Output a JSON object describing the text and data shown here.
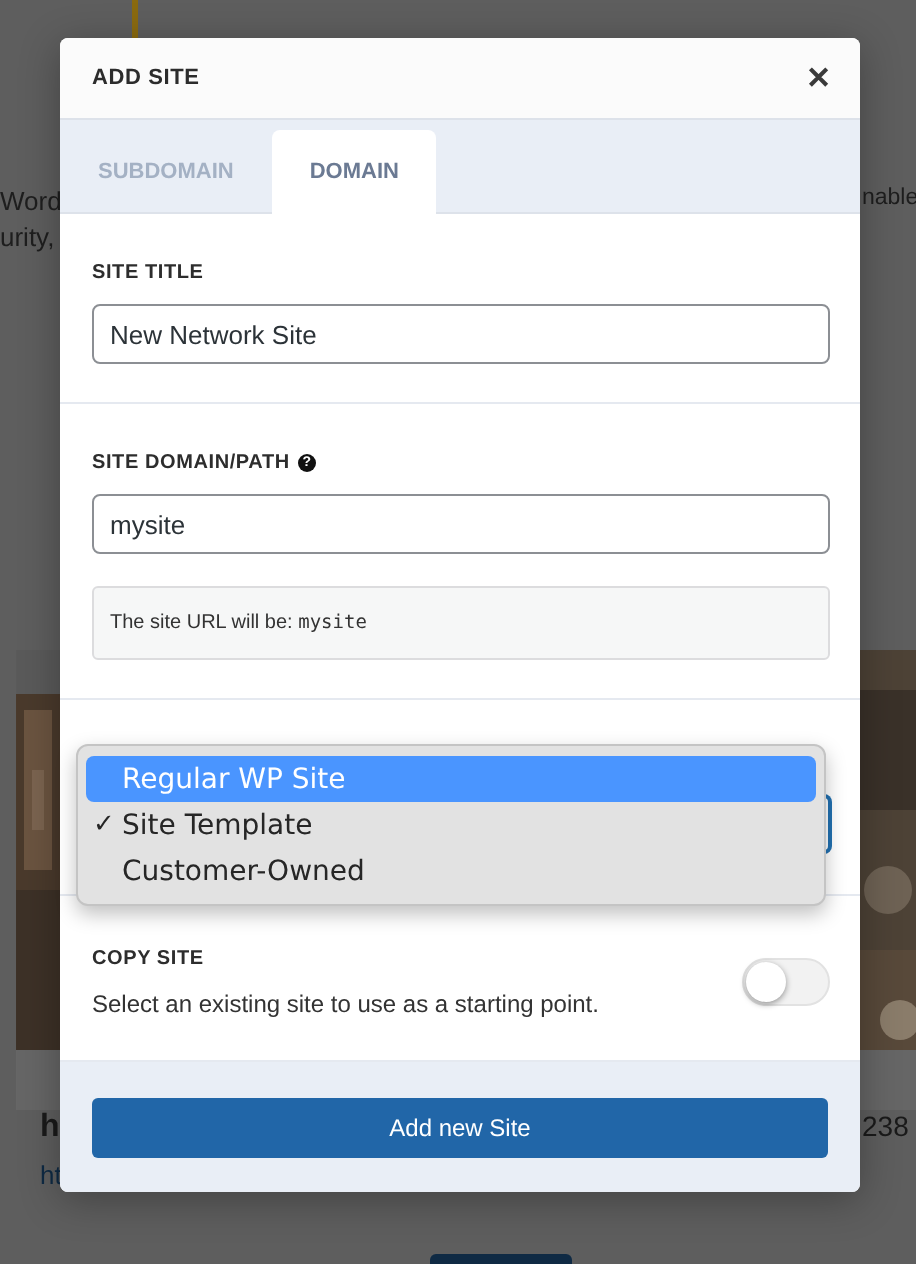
{
  "background": {
    "left_lines": [
      "Word",
      "urity,"
    ],
    "right_lines": [
      "nable"
    ],
    "left_card_title": "h",
    "left_card_link": "ht",
    "right_card_title": "238"
  },
  "modal": {
    "title": "ADD SITE",
    "close": "✕",
    "tabs": [
      {
        "label": "SUBDOMAIN",
        "selected": false
      },
      {
        "label": "DOMAIN",
        "selected": true
      }
    ],
    "site_title": {
      "label": "SITE TITLE",
      "value": "New Network Site"
    },
    "domain": {
      "label": "SITE DOMAIN/PATH",
      "help": "?",
      "value": "mysite",
      "hint": "The site URL will be: ",
      "hint_code": "mysite"
    },
    "type_menu": {
      "options": [
        {
          "label": "Regular WP Site",
          "selected": true,
          "checked": false
        },
        {
          "label": "Site Template",
          "selected": false,
          "checked": true
        },
        {
          "label": "Customer-Owned",
          "selected": false,
          "checked": false
        }
      ],
      "check": "✓"
    },
    "copy_site": {
      "label": "COPY SITE",
      "description": "Select an existing site to use as a starting point.",
      "on": false
    },
    "submit": "Add new Site"
  }
}
